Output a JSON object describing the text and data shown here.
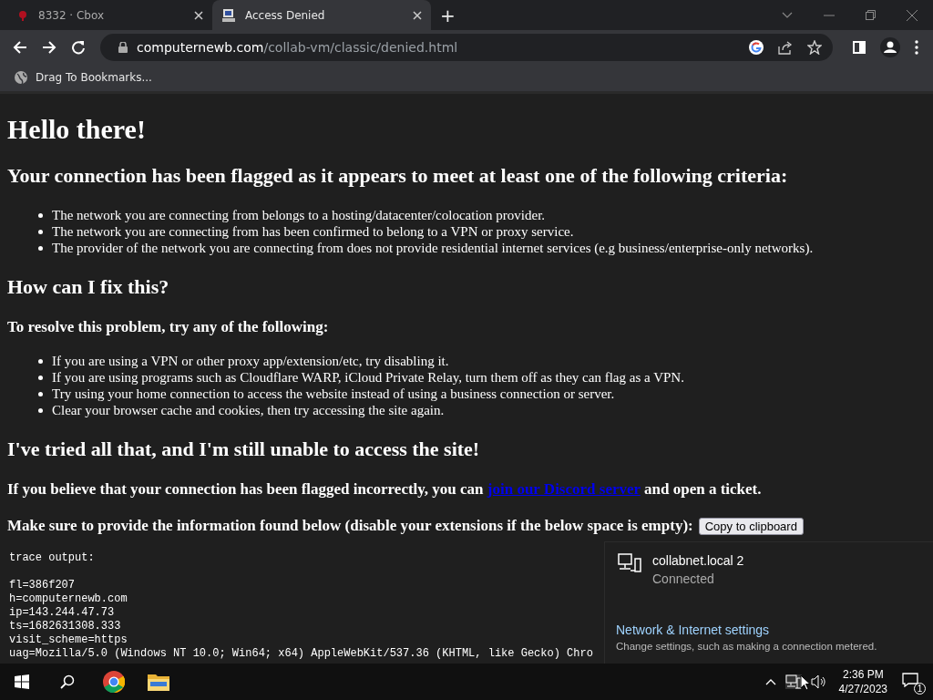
{
  "browser": {
    "tabs": [
      {
        "title": "8332 · Cbox",
        "selected": false
      },
      {
        "title": "Access Denied",
        "selected": true
      }
    ],
    "new_tab": "+",
    "address": {
      "domain": "computernewb.com",
      "path": "/collab-vm/classic/denied.html"
    },
    "bookmarks_bar": {
      "hint": "Drag To Bookmarks..."
    }
  },
  "page": {
    "blocks": [
      {
        "kind": "h1",
        "text": "Hello there!"
      },
      {
        "kind": "h2",
        "text": "Your connection has been flagged as it appears to meet at least one of the following criteria:"
      },
      {
        "kind": "list",
        "items": [
          "The network you are connecting from belongs to a hosting/datacenter/colocation provider.",
          "The network you are connecting from has been confirmed to belong to a VPN or proxy service.",
          "The provider of the network you are connecting from does not provide residential internet services (e.g business/enterprise-only networks)."
        ]
      },
      {
        "kind": "h2",
        "text": "How can I fix this?"
      },
      {
        "kind": "h3",
        "text": "To resolve this problem, try any of the following:"
      },
      {
        "kind": "list",
        "items": [
          "If you are using a VPN or other proxy app/extension/etc, try disabling it.",
          "If you are using programs such as Cloudflare WARP, iCloud Private Relay, turn them off as they can flag as a VPN.",
          "Try using your home connection to access the website instead of using a business connection or server.",
          "Clear your browser cache and cookies, then try accessing the site again."
        ]
      },
      {
        "kind": "h2",
        "text": "I've tried all that, and I'm still unable to access the site!"
      },
      {
        "kind": "link_line",
        "before": "If you believe that your connection has been flagged incorrectly, you can ",
        "link": "join our Discord server",
        "after": " and open a ticket."
      },
      {
        "kind": "button_line",
        "text": "Make sure to provide the information found below (disable your extensions if the below space is empty):",
        "button": "Copy to clipboard"
      },
      {
        "kind": "pre",
        "header": "trace output:",
        "lines": [
          "fl=386f207",
          "h=computernewb.com",
          "ip=143.244.47.73",
          "ts=1682631308.333",
          "visit_scheme=https",
          "uag=Mozilla/5.0 (Windows NT 10.0; Win64; x64) AppleWebKit/537.36 (KHTML, like Gecko) Chro"
        ]
      }
    ]
  },
  "network_flyout": {
    "network": "collabnet.local 2",
    "status": "Connected",
    "settings_link": "Network & Internet settings",
    "settings_hint": "Change settings, such as making a connection metered."
  },
  "taskbar": {
    "time": "2:36 PM",
    "date": "4/27/2023",
    "notifications": "1"
  }
}
